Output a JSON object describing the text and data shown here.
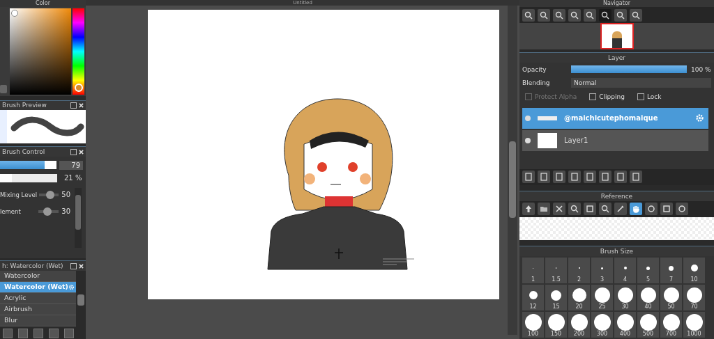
{
  "color_panel": {
    "title": "Color"
  },
  "brush_preview": {
    "title": "Brush Preview"
  },
  "brush_control": {
    "title": "Brush Control",
    "size": {
      "level": 0.79,
      "value": "79"
    },
    "opacity": {
      "level": 0.21,
      "value": "21 %"
    },
    "sliders": [
      {
        "label": "Mixing Level",
        "level": 0.6,
        "value": "50"
      },
      {
        "label": "lement",
        "level": 0.4,
        "value": "30"
      }
    ]
  },
  "brush_list": {
    "title": "h: Watercolor (Wet)",
    "items": [
      {
        "label": "Watercolor",
        "selected": false
      },
      {
        "label": "Watercolor (Wet)",
        "selected": true
      },
      {
        "label": "Acrylic",
        "selected": false
      },
      {
        "label": "Airbrush",
        "selected": false
      },
      {
        "label": "Blur",
        "selected": false
      }
    ]
  },
  "canvas": {
    "title": "Untitled"
  },
  "navigator": {
    "title": "Navigator"
  },
  "layer": {
    "title": "Layer",
    "opacity": {
      "label": "Opacity",
      "level": 1,
      "value": "100 %"
    },
    "blending": {
      "label": "Blending",
      "value": "Normal"
    },
    "options": [
      {
        "label": "Protect Alpha",
        "checked": false,
        "disabled": true
      },
      {
        "label": "Clipping",
        "checked": false,
        "disabled": false
      },
      {
        "label": "Lock",
        "checked": false,
        "disabled": false
      }
    ],
    "layers": [
      {
        "name": "@maichicutephomaique",
        "selected": true,
        "kind": "text"
      },
      {
        "name": "Layer1",
        "selected": false,
        "kind": "image"
      }
    ]
  },
  "reference": {
    "title": "Reference",
    "tools": [
      {
        "kind": "upload",
        "selected": false
      },
      {
        "kind": "open",
        "selected": false
      },
      {
        "kind": "close",
        "selected": false
      },
      {
        "kind": "zoom-in",
        "selected": false
      },
      {
        "kind": "fit",
        "selected": false
      },
      {
        "kind": "zoom-out",
        "selected": false
      },
      {
        "kind": "picker",
        "selected": false
      },
      {
        "kind": "hand",
        "selected": true
      },
      {
        "kind": "rotate",
        "selected": false
      },
      {
        "kind": "frame",
        "selected": false
      },
      {
        "kind": "rotate",
        "selected": false
      }
    ]
  },
  "brush_size": {
    "title": "Brush Size",
    "sizes": [
      "1",
      "1.5",
      "2",
      "3",
      "4",
      "5",
      "7",
      "10",
      "12",
      "15",
      "20",
      "25",
      "30",
      "40",
      "50",
      "70",
      "100",
      "150",
      "200",
      "300",
      "400",
      "500",
      "700",
      "1000"
    ]
  }
}
